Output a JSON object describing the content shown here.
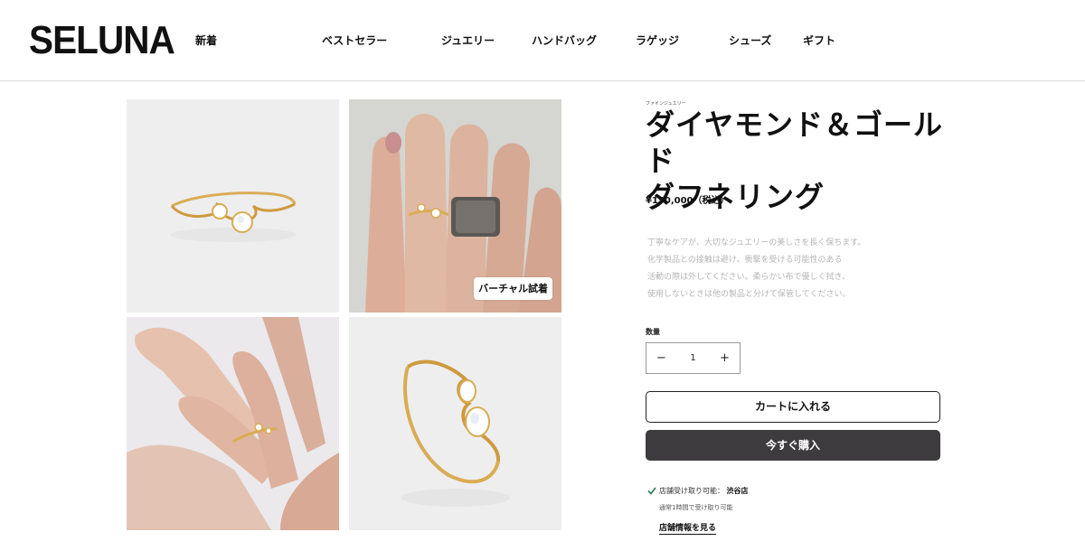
{
  "brand": {
    "logo_text": "SELUNA"
  },
  "nav": {
    "items": [
      {
        "label": "新着"
      },
      {
        "label": "ベストセラー"
      },
      {
        "label": "ジュエリー"
      },
      {
        "label": "ハンドバッグ"
      },
      {
        "label": "ラゲッジ"
      },
      {
        "label": "シューズ"
      },
      {
        "label": "ギフト"
      }
    ]
  },
  "gallery": {
    "images": [
      {
        "subject": "ring-product-shot"
      },
      {
        "subject": "ring-on-hand-with-second-ring"
      },
      {
        "subject": "ring-worn-on-hand"
      },
      {
        "subject": "ring-product-closeup"
      }
    ],
    "virtual_tryon_label": "バーチャル試着"
  },
  "product": {
    "category": "ファインジュエリー",
    "title_line1": "ダイヤモンド＆ゴールド",
    "title_line2": "ダフネリング",
    "price": "¥150,000（税込）",
    "description": [
      "丁寧なケアが、大切なジュエリーの美しさを長く保ちます。",
      "化学製品との接触は避け、衝撃を受ける可能性のある",
      "活動の際は外してください。柔らかい布で優しく拭き、",
      "使用しないときは他の製品と分けて保管してください。"
    ],
    "quantity_label": "数量",
    "quantity_value": "1",
    "minus_symbol": "−",
    "plus_symbol": "+",
    "add_to_cart_label": "カートに入れる",
    "buy_now_label": "今すぐ購入"
  },
  "pickup": {
    "status_text": "店舗受け取り可能：",
    "store_name": "渋谷店",
    "sub_text": "通常1時間で受け取り可能",
    "link_text": "店舗情報を見る"
  },
  "colors": {
    "buy_button_bg": "#3d3b3e",
    "check_icon": "#2f7d4f",
    "gold": "#d9ac55",
    "skin": "#e0b9a4"
  }
}
